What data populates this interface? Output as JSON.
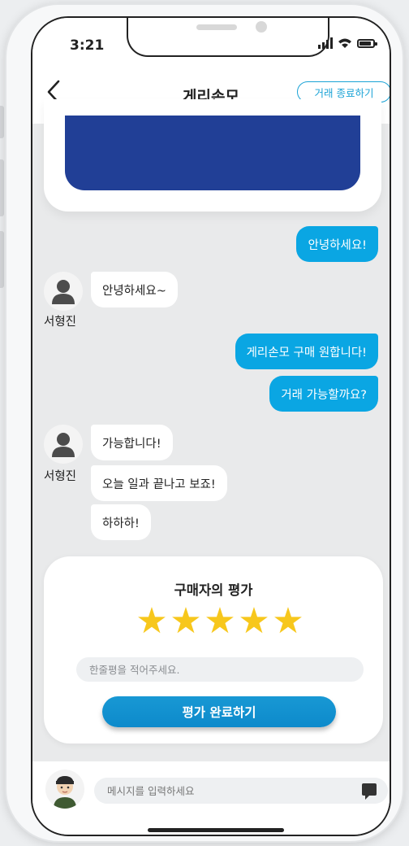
{
  "status": {
    "time": "3:21"
  },
  "header": {
    "title": "게리손모",
    "end_button": "거래 종료하기"
  },
  "messages": [
    {
      "from": "me",
      "text": "안녕하세요!"
    },
    {
      "from": "other",
      "text": "안녕하세요~"
    },
    {
      "from": "me",
      "text": "게리손모 구매 원합니다!"
    },
    {
      "from": "me",
      "text": "거래 가능할까요?"
    },
    {
      "from": "other",
      "text": "가능합니다!"
    },
    {
      "from": "other",
      "text": "오늘 일과 끝나고 보죠!"
    },
    {
      "from": "other",
      "text": "하하하!"
    }
  ],
  "sender_name": "서형진",
  "review": {
    "title": "구매자의 평가",
    "rating": 5,
    "max_rating": 5,
    "placeholder": "한줄평을 적어주세요.",
    "submit_label": "평가 완료하기"
  },
  "composer": {
    "placeholder": "메시지를 입력하세요"
  },
  "icons": {
    "back": "chevron-left-icon",
    "send": "chat-bubble-icon",
    "star": "star-icon"
  },
  "colors": {
    "accent": "#0aa6e3",
    "product": "#213f96",
    "star": "#f7c71c"
  }
}
